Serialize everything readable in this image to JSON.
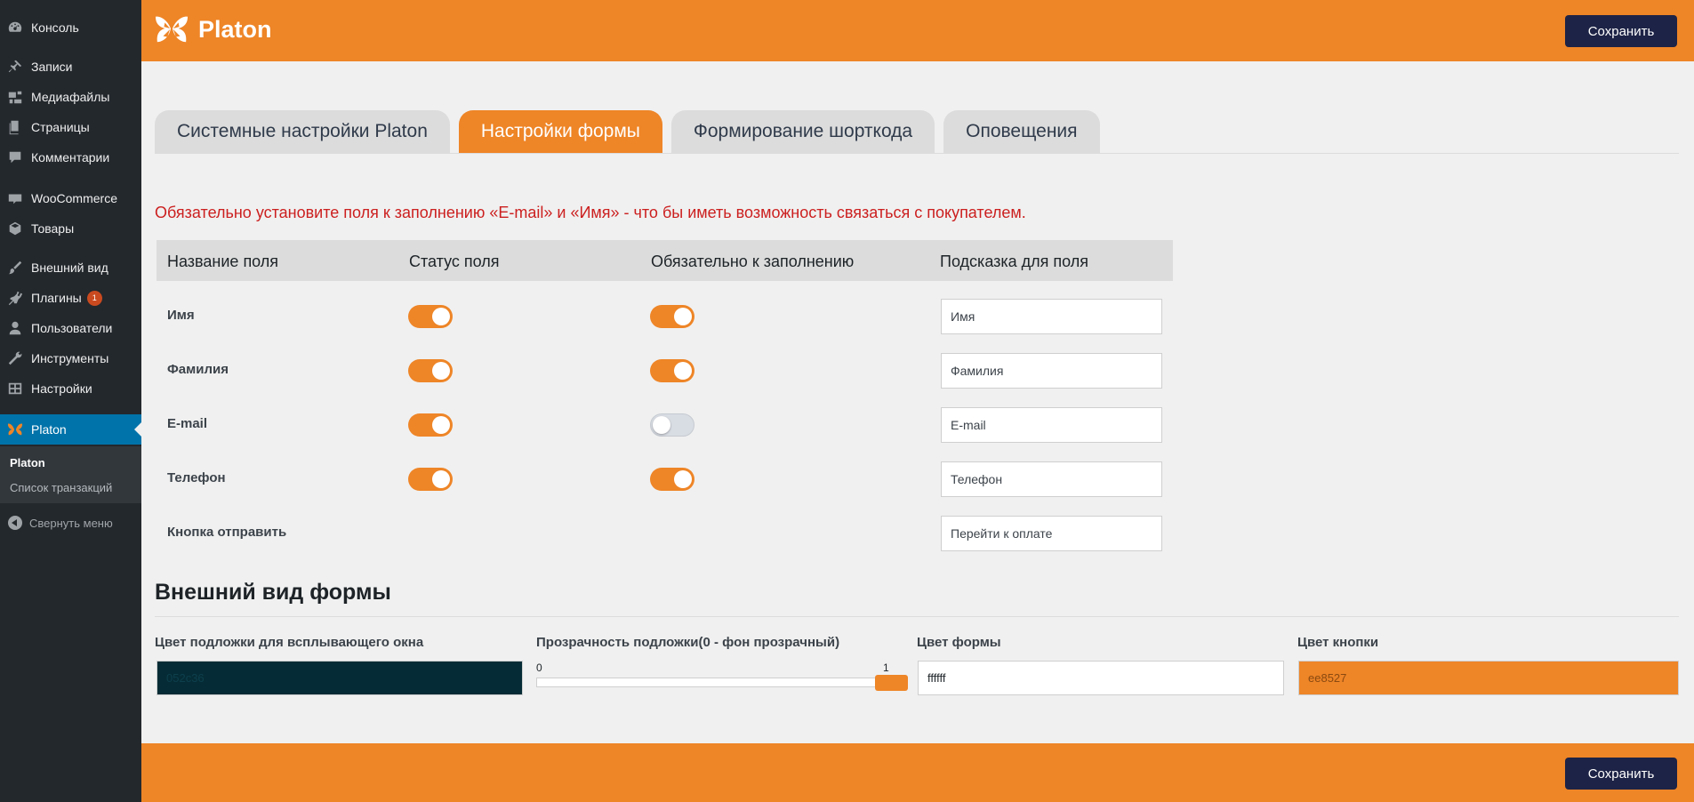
{
  "sidebar": {
    "items": [
      {
        "label": "Консоль",
        "icon": "dashboard-icon"
      },
      {
        "label": "Записи",
        "icon": "pin-icon"
      },
      {
        "label": "Медиафайлы",
        "icon": "media-icon"
      },
      {
        "label": "Страницы",
        "icon": "pages-icon"
      },
      {
        "label": "Комментарии",
        "icon": "comments-icon"
      },
      {
        "label": "WooCommerce",
        "icon": "woocommerce-icon"
      },
      {
        "label": "Товары",
        "icon": "products-icon"
      },
      {
        "label": "Внешний вид",
        "icon": "brush-icon"
      },
      {
        "label": "Плагины",
        "icon": "plugins-icon",
        "badge": "1"
      },
      {
        "label": "Пользователи",
        "icon": "users-icon"
      },
      {
        "label": "Инструменты",
        "icon": "tools-icon"
      },
      {
        "label": "Настройки",
        "icon": "settings-icon"
      },
      {
        "label": "Platon",
        "icon": "butterfly-icon"
      }
    ],
    "submenu": [
      "Platon",
      "Список транзакций"
    ],
    "collapse_label": "Свернуть меню"
  },
  "header": {
    "logo_text": "Platon",
    "save_label": "Сохранить"
  },
  "tabs": [
    {
      "label": "Системные настройки Platon",
      "active": false
    },
    {
      "label": "Настройки формы",
      "active": true
    },
    {
      "label": "Формирование шорткода",
      "active": false
    },
    {
      "label": "Оповещения",
      "active": false
    }
  ],
  "warning": "Обязательно установите поля к заполнению «E-mail» и «Имя» - что бы иметь возможность связаться с покупателем.",
  "fields_table": {
    "headers": [
      "Название поля",
      "Статус поля",
      "Обязательно к заполнению",
      "Подсказка для поля"
    ],
    "rows": [
      {
        "name": "Имя",
        "status": true,
        "required": true,
        "hint": "Имя"
      },
      {
        "name": "Фамилия",
        "status": true,
        "required": true,
        "hint": "Фамилия"
      },
      {
        "name": "E-mail",
        "status": true,
        "required": false,
        "hint": "E-mail"
      },
      {
        "name": "Телефон",
        "status": true,
        "required": true,
        "hint": "Телефон"
      },
      {
        "name": "Кнопка отправить",
        "hint": "Перейти к оплате"
      }
    ]
  },
  "appearance": {
    "title": "Внешний вид формы",
    "overlay_color_label": "Цвет подложки для всплывающего окна",
    "overlay_color_value": "052c36",
    "opacity_label": "Прозрачность подложки(0 - фон прозрачный)",
    "opacity_min": "0",
    "opacity_max": "1",
    "opacity_value": 1,
    "form_color_label": "Цвет формы",
    "form_color_value": "ffffff",
    "button_color_label": "Цвет кнопки",
    "button_color_value": "ee8527"
  },
  "footer": {
    "save_label": "Сохранить"
  },
  "colors": {
    "accent": "#ee8527",
    "dark_button": "#1d2346",
    "sidebar_bg": "#23282d",
    "sidebar_active": "#0073aa",
    "overlay_color": "#052c36",
    "warning_text": "#cc1f1f"
  }
}
